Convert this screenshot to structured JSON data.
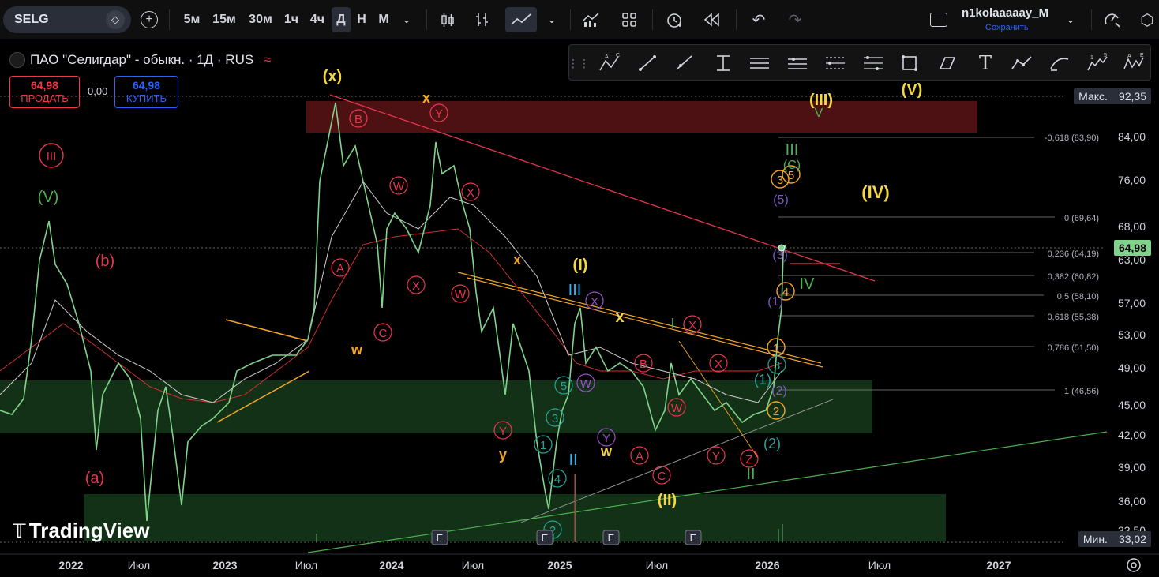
{
  "toolbar": {
    "symbol": "SELG",
    "intervals": [
      "5м",
      "15м",
      "30м",
      "1ч",
      "4ч",
      "Д",
      "Н",
      "М"
    ],
    "active_interval": "Д",
    "user": "n1kolaaaaay_M",
    "save_label": "Сохранить"
  },
  "legend": {
    "title": "ПАО \"Селигдар\" - обыкн. · 1Д · RUS",
    "sell_price": "64,98",
    "sell_label": "ПРОДАТЬ",
    "spread": "0,00",
    "buy_price": "64,98",
    "buy_label": "КУПИТЬ"
  },
  "price_axis": {
    "max_label": "Макс.",
    "max_value": "92,35",
    "min_label": "Мин.",
    "min_value": "33,02",
    "current": "64,98",
    "ticks": [
      "84,00",
      "76,00",
      "68,00",
      "63,00",
      "57,00",
      "53,00",
      "49,00",
      "45,00",
      "42,00",
      "39,00",
      "36,00",
      "33,50"
    ]
  },
  "time_axis": {
    "ticks": [
      "2022",
      "Июл",
      "2023",
      "Июл",
      "2024",
      "Июл",
      "2025",
      "Июл",
      "2026",
      "Июл",
      "2027"
    ]
  },
  "fib_levels": [
    "-0,618 (83,90)",
    "0 (69,64)",
    "0,236 (64,19)",
    "0,382 (60,82)",
    "0,5 (58,10)",
    "0,618 (55,38)",
    "0,786 (51,50)",
    "1 (46,56)"
  ],
  "wave_labels": {
    "x_top": "(x)",
    "iii_red": "III",
    "v_green": "(V)",
    "b_red": "(b)",
    "a_red": "(a)",
    "w_orange": "w",
    "x_orange": "x",
    "y_orange": "y",
    "w_yellow": "w",
    "x_yellow": "x",
    "iii_top": "(III)",
    "v_top": "(V)",
    "iv_yellow": "(IV)",
    "ii_yellow": "(II)",
    "i_yellow": "(I)",
    "iv_green": "IV",
    "iii_green": "III",
    "ii_green": "II",
    "ii_cyan": "II",
    "iii_cyan": "III",
    "i_green": "I",
    "v_green_small": "V",
    "c_green": "(C)",
    "earnings": "E"
  },
  "colors": {
    "price_line": "#7fd38a",
    "red_zone": "#5a1418",
    "green_zone": "#143618",
    "downtrend": "#e8364f",
    "channel": "#f5a623",
    "sell": "#f23645",
    "buy": "#2962ff"
  },
  "branding": {
    "logo": "TradingView"
  }
}
